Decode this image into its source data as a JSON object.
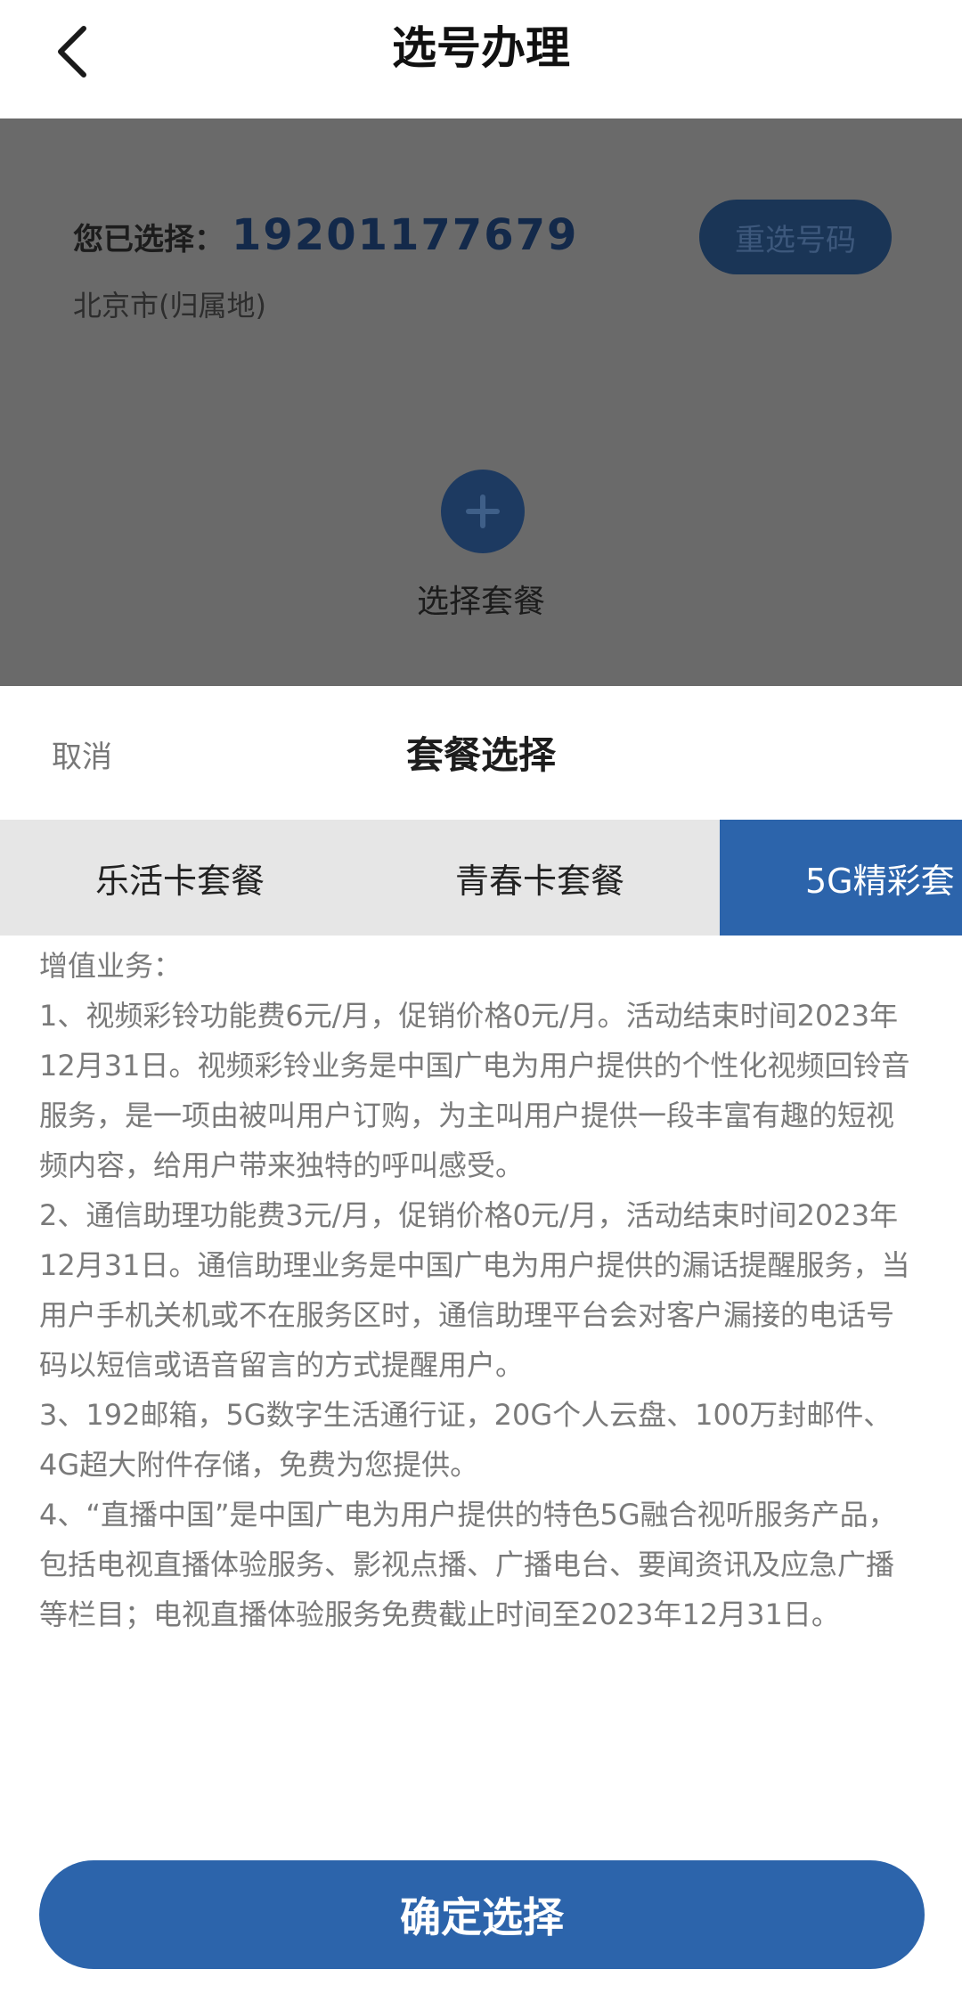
{
  "header": {
    "title": "选号办理",
    "back_icon": "chevron-left-icon"
  },
  "selection": {
    "label": "您已选择：",
    "number": "19201177679",
    "region": "北京市(归属地)",
    "reselect_label": "重选号码",
    "choose_plan_label": "选择套餐",
    "plus_icon": "plus-icon"
  },
  "sheet": {
    "cancel_label": "取消",
    "title": "套餐选择",
    "tabs": [
      {
        "label": "乐活卡套餐",
        "active": false
      },
      {
        "label": "青春卡套餐",
        "active": false
      },
      {
        "label": "5G精彩套",
        "active": true
      }
    ],
    "content": {
      "heading": "增值业务：",
      "items": [
        "1、视频彩铃功能费6元/月，促销价格0元/月。活动结束时间2023年12月31日。视频彩铃业务是中国广电为用户提供的个性化视频回铃音服务，是一项由被叫用户订购，为主叫用户提供一段丰富有趣的短视频内容，给用户带来独特的呼叫感受。",
        "2、通信助理功能费3元/月，促销价格0元/月，活动结束时间2023年12月31日。通信助理业务是中国广电为用户提供的漏话提醒服务，当用户手机关机或不在服务区时，通信助理平台会对客户漏接的电话号码以短信或语音留言的方式提醒用户。",
        "3、192邮箱，5G数字生活通行证，20G个人云盘、100万封邮件、4G超大附件存储，免费为您提供。",
        "4、“直播中国”是中国广电为用户提供的特色5G融合视听服务产品，包括电视直播体验服务、影视点播、广播电台、要闻资讯及应急广播等栏目；电视直播体验服务免费截止时间至2023年12月31日。"
      ]
    },
    "confirm_label": "确定选择"
  },
  "colors": {
    "accent": "#2c64ab",
    "overlay": "#6a6a6a",
    "tab_bg": "#e6e6e6",
    "number": "#13294a"
  }
}
